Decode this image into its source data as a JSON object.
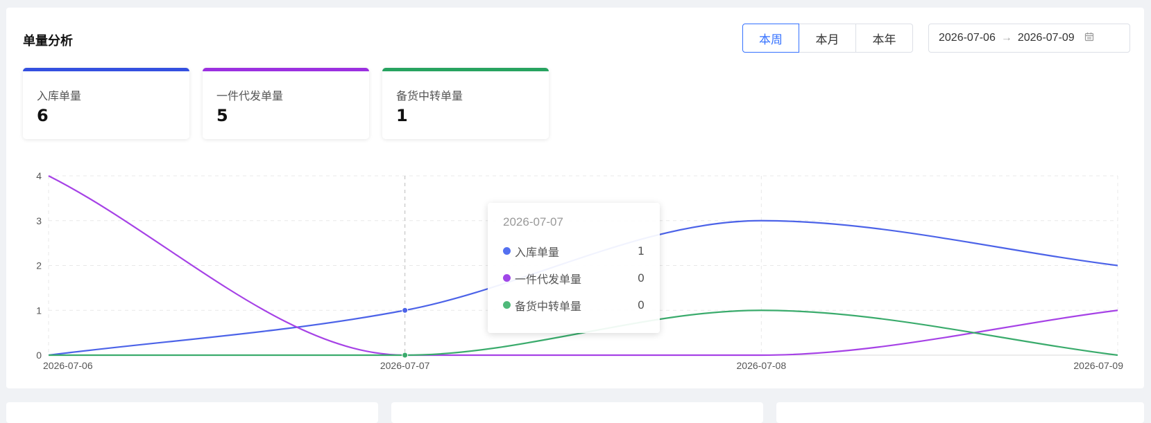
{
  "panel": {
    "title": "单量分析",
    "tabs": [
      {
        "label": "本周",
        "active": true
      },
      {
        "label": "本月",
        "active": false
      },
      {
        "label": "本年",
        "active": false
      }
    ],
    "date_range": {
      "start": "2026-07-06",
      "end": "2026-07-09"
    }
  },
  "stats": [
    {
      "label": "入库单量",
      "value": "6",
      "color": "#3450e0"
    },
    {
      "label": "一件代发单量",
      "value": "5",
      "color": "#9b30e0"
    },
    {
      "label": "备货中转单量",
      "value": "1",
      "color": "#27a360"
    }
  ],
  "tooltip": {
    "title": "2026-07-07",
    "rows": [
      {
        "name": "入库单量",
        "value": "1",
        "color": "#5470f0"
      },
      {
        "name": "一件代发单量",
        "value": "0",
        "color": "#a047e8"
      },
      {
        "name": "备货中转单量",
        "value": "0",
        "color": "#4fb97a"
      }
    ]
  },
  "chart_data": {
    "type": "line",
    "x": [
      "2026-07-06",
      "2026-07-07",
      "2026-07-08",
      "2026-07-09"
    ],
    "series": [
      {
        "name": "入库单量",
        "values": [
          0,
          1,
          3,
          2
        ],
        "color": "#4c63e8"
      },
      {
        "name": "一件代发单量",
        "values": [
          4,
          0,
          0,
          1
        ],
        "color": "#a642e6"
      },
      {
        "name": "备货中转单量",
        "values": [
          0,
          0,
          1,
          0
        ],
        "color": "#3aab6c"
      }
    ],
    "ylim": [
      0,
      4
    ],
    "yticks": [
      0,
      1,
      2,
      3,
      4
    ],
    "smooth": true,
    "grid": true,
    "highlight_index": 1
  }
}
